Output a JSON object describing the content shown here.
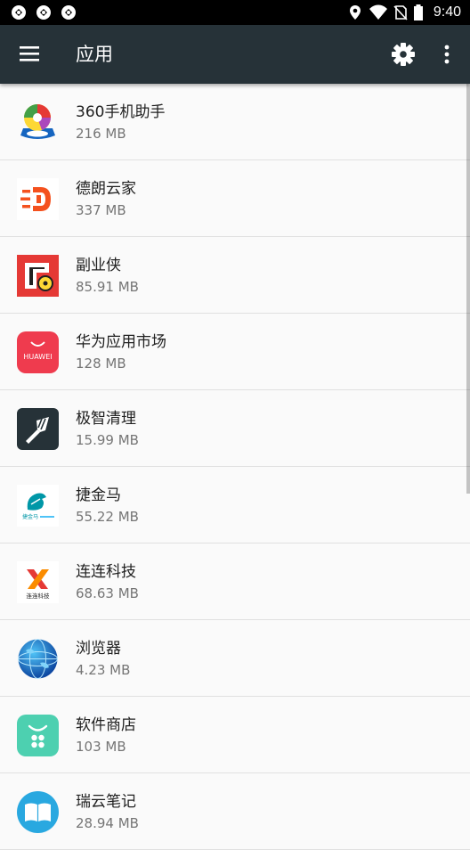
{
  "status_bar": {
    "time": "9:40"
  },
  "header": {
    "title": "应用"
  },
  "colors": {
    "app_bar": "#263238",
    "status_bar": "#000000",
    "background": "#fafafa"
  },
  "apps": [
    {
      "name": "360手机助手",
      "size": "216 MB"
    },
    {
      "name": "德朗云家",
      "size": "337 MB"
    },
    {
      "name": "副业侠",
      "size": "85.91 MB"
    },
    {
      "name": "华为应用市场",
      "size": "128 MB",
      "icon_text": "HUAWEI"
    },
    {
      "name": "极智清理",
      "size": "15.99 MB"
    },
    {
      "name": "捷金马",
      "size": "55.22 MB",
      "icon_text": "捷金马"
    },
    {
      "name": "连连科技",
      "size": "68.63 MB",
      "icon_text": "连连科技"
    },
    {
      "name": "浏览器",
      "size": "4.23 MB"
    },
    {
      "name": "软件商店",
      "size": "103 MB"
    },
    {
      "name": "瑞云笔记",
      "size": "28.94 MB"
    }
  ]
}
